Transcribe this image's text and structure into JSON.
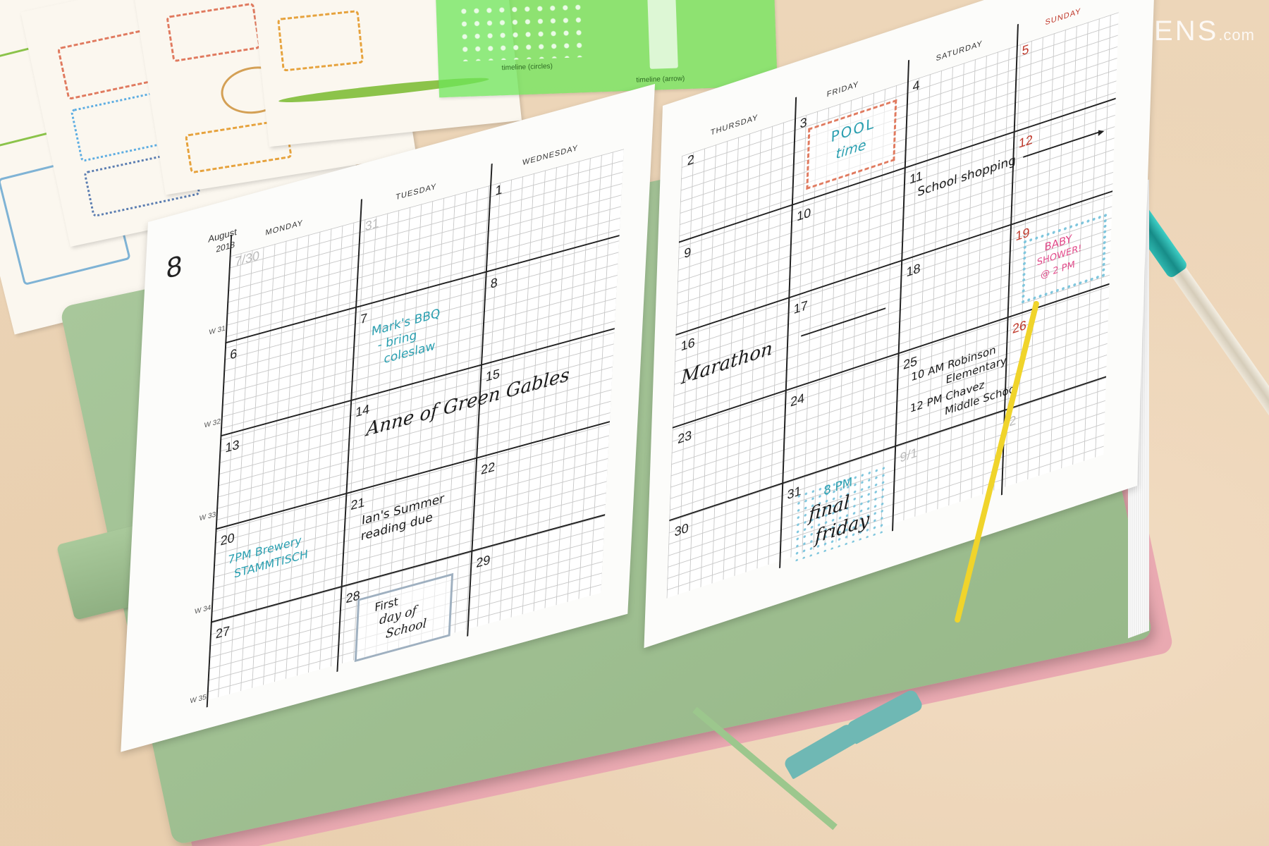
{
  "watermark": {
    "brand": "JETPENS",
    "suffix": ".com"
  },
  "planner": {
    "month_number": "8",
    "month_name": "August",
    "year": "2018",
    "days": [
      "MONDAY",
      "TUESDAY",
      "WEDNESDAY",
      "THURSDAY",
      "FRIDAY",
      "SATURDAY",
      "SUNDAY"
    ],
    "week_labels": [
      "W 31",
      "W 32",
      "W 33",
      "W 34",
      "W 35"
    ],
    "dates_left": [
      "7/30",
      "31",
      "1",
      "6",
      "7",
      "8",
      "13",
      "14",
      "15",
      "20",
      "21",
      "22",
      "27",
      "28",
      "29"
    ],
    "dates_right": [
      "2",
      "3",
      "4",
      "5",
      "9",
      "10",
      "11",
      "12",
      "16",
      "17",
      "18",
      "19",
      "23",
      "24",
      "25",
      "26",
      "30",
      "31",
      "9/1",
      "2"
    ]
  },
  "entries": {
    "marks_bbq_1": "Mark's BBQ",
    "marks_bbq_2": "- bring",
    "marks_bbq_3": "coleslaw",
    "anne": "Anne of Green Gables",
    "marathon": "Marathon",
    "ians_1": "Ian's Summer",
    "ians_2": "reading due",
    "brewery_1": "7PM Brewery",
    "brewery_2": "STAMMTISCH",
    "first_day_1": "First",
    "first_day_2": "day of",
    "first_day_3": "School",
    "pool_1": "POOL",
    "pool_2": "time",
    "school_shopping": "School shopping",
    "baby_1": "BABY",
    "baby_2": "SHOWER!",
    "baby_3": "@ 2 PM",
    "robinson_1": "10 AM Robinson",
    "robinson_2": "Elementary",
    "chavez_1": "12 PM Chavez",
    "chavez_2": "Middle School",
    "final_1": "8 PM",
    "final_2": "final",
    "final_3": "friday"
  },
  "stencil": {
    "label_1": "timeline (circles)",
    "label_2": "timeline (arrow)"
  },
  "colors": {
    "cover": "#a8c79b",
    "accent_teal": "#2a9fb0",
    "accent_pink": "#e24a8a",
    "sunday_red": "#c0392b",
    "band_yellow": "#f0d42b"
  }
}
